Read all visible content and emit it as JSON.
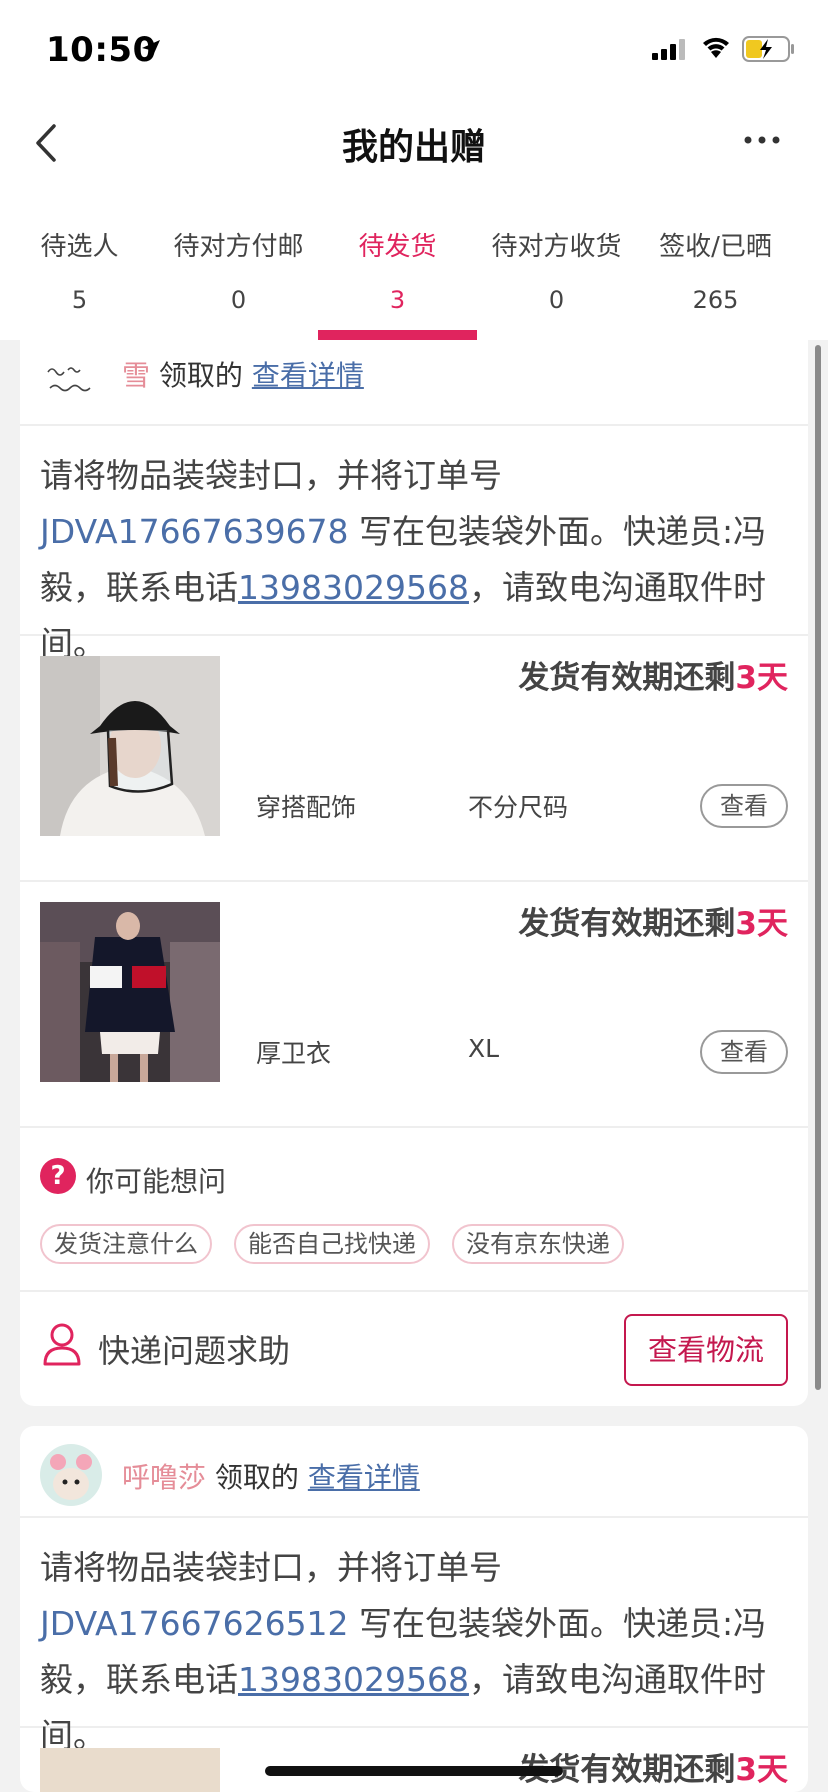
{
  "status": {
    "time": "10:50"
  },
  "nav": {
    "title": "我的出赠"
  },
  "tabs": [
    {
      "label": "待选人",
      "count": "5"
    },
    {
      "label": "待对方付邮",
      "count": "0"
    },
    {
      "label": "待发货",
      "count": "3"
    },
    {
      "label": "待对方收货",
      "count": "0"
    },
    {
      "label": "签收/已晒",
      "count": "265"
    }
  ],
  "colors": {
    "accent": "#e0245e",
    "link": "#4a6ea8",
    "button_border": "#c4184e"
  },
  "cards": [
    {
      "recipient": "雪",
      "claimed_text": "领取的",
      "detail_link": "查看详情",
      "instr_prefix": "请将物品装袋封口，并将订单号 ",
      "order_no": "JDVA17667639678",
      "instr_mid": " 写在包装袋外面。快递员:冯毅，联系电话",
      "phone": "13983029568",
      "instr_suffix": "，请致电沟通取件时间。",
      "items": [
        {
          "deadline_prefix": "发货有效期还剩",
          "deadline_days": "3天",
          "category": "穿搭配饰",
          "size": "不分尺码",
          "view": "查看",
          "image": "photo-bucket-hat-face-shield"
        },
        {
          "deadline_prefix": "发货有效期还剩",
          "deadline_days": "3天",
          "category": "厚卫衣",
          "size": "XL",
          "view": "查看",
          "image": "photo-runway-hoodie"
        }
      ],
      "faq": {
        "title": "你可能想问",
        "chips": [
          "发货注意什么",
          "能否自己找快递",
          "没有京东快递"
        ]
      },
      "help": {
        "label": "快递问题求助",
        "button": "查看物流"
      }
    },
    {
      "recipient": "呼噜莎",
      "claimed_text": "领取的",
      "detail_link": "查看详情",
      "instr_prefix": "请将物品装袋封口，并将订单号 ",
      "order_no": "JDVA17667626512",
      "instr_mid": " 写在包装袋外面。快递员:冯毅，联系电话",
      "phone": "13983029568",
      "instr_suffix": "，请致电沟通取件时间。",
      "items": [
        {
          "deadline_prefix": "发货有效期还剩",
          "deadline_days": "3天"
        }
      ]
    }
  ]
}
